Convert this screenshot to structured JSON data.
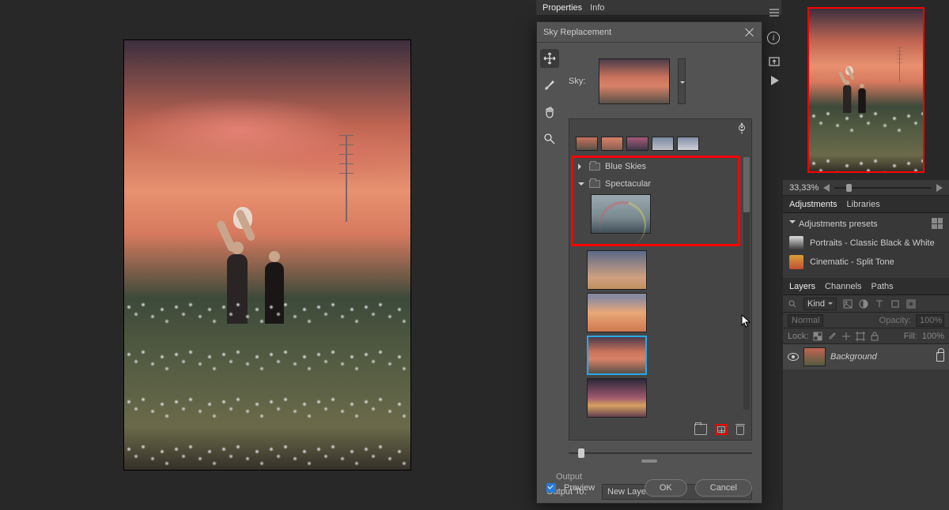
{
  "panels_top": {
    "properties": "Properties",
    "info": "Info"
  },
  "dialog": {
    "title": "Sky Replacement",
    "sky_label": "Sky:",
    "folders": {
      "blue": "Blue Skies",
      "spectacular": "Spectacular"
    },
    "output_section": "Output",
    "output_to_label": "Output To:",
    "output_to_value": "New Layers",
    "preview_label": "Preview",
    "ok": "OK",
    "cancel": "Cancel"
  },
  "navigator": {
    "zoom": "33,33%"
  },
  "adjustments": {
    "tab_adj": "Adjustments",
    "tab_lib": "Libraries",
    "header": "Adjustments presets",
    "presets": [
      "Portraits - Classic Black & White",
      "Cinematic - Split Tone"
    ]
  },
  "layers": {
    "tab_layers": "Layers",
    "tab_channels": "Channels",
    "tab_paths": "Paths",
    "kind": "Kind",
    "blend": "Normal",
    "opacity_label": "Opacity:",
    "opacity_val": "100%",
    "lock_label": "Lock:",
    "fill_label": "Fill:",
    "fill_val": "100%",
    "bg_layer": "Background"
  }
}
